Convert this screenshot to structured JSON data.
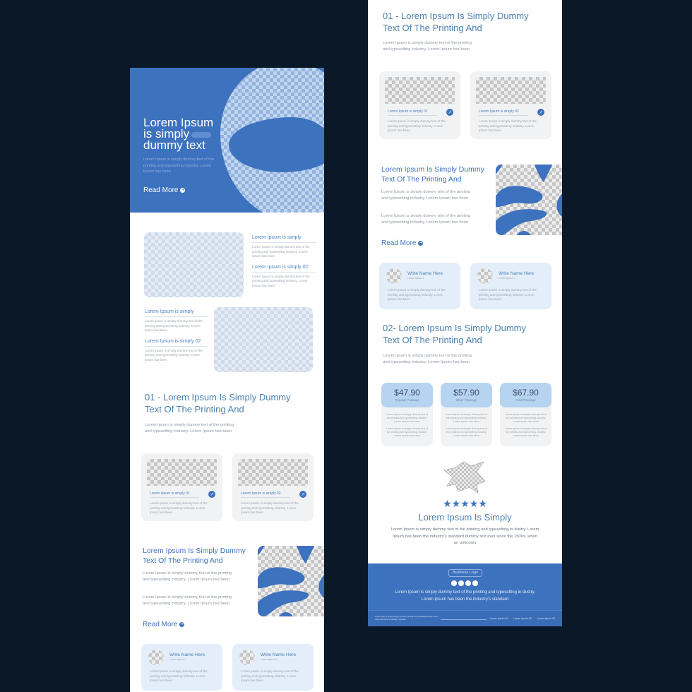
{
  "colors": {
    "background": "#0a1828",
    "brand_blue": "#3d72be",
    "heading_blue": "#4a7fb0",
    "price_header": "#b6d3f0",
    "testimonial_card": "#e3eefa",
    "card_grey": "#f1f2f4"
  },
  "left_page": {
    "hero": {
      "title_line1": "Lorem Ipsum",
      "title_line2": "is simply",
      "title_line3": "dummy text",
      "body": "Lorem Ipsum is simply dummy text of the printing and typesetting industry. Lorem Ipsum has been",
      "read_more": "Read More",
      "read_more_icon": "arrow-circle-icon"
    },
    "features": {
      "row1": [
        {
          "title": "Lorem Ipsum is simply",
          "body": "Lorem Ipsum is simply dummy text of the printing and typesetting industry. Lorem Ipsum has been"
        },
        {
          "title": "Lorem Ipsum is simply 02",
          "body": "Lorem Ipsum is simply dummy text of the printing and typesetting industry. Lorem Ipsum has been"
        }
      ],
      "row2": [
        {
          "title": "Lorem Ipsum is simply",
          "body": "Lorem Ipsum is simply dummy text of the printing and typesetting industry. Lorem Ipsum has been"
        },
        {
          "title": "Lorem Ipsum is simply 02",
          "body": "Lorem Ipsum is simply dummy text of the printing and typesetting industry. Lorem Ipsum has been"
        }
      ]
    },
    "section01": {
      "title_line1": "01 - Lorem Ipsum Is Simply Dummy",
      "title_line2": "Text Of The Printing And",
      "body": "Lorem Ipsum is simply dummy text of the printing and typesetting industry. Lorem Ipsum has been",
      "cards": [
        {
          "title": "Lorem Ipsum is simply 01",
          "body": "Lorem Ipsum is simply dummy text of the printing and typesetting industry. Lorem Ipsum has been",
          "icon": "arrow-up-right-icon"
        },
        {
          "title": "Lorem Ipsum is simply 02",
          "body": "Lorem Ipsum is simply dummy text of the printing and typesetting industry. Lorem Ipsum has been",
          "icon": "arrow-up-right-icon"
        }
      ]
    },
    "split": {
      "title_line1": "Lorem Ipsum Is Simply Dummy",
      "title_line2": "Text Of The Printing And",
      "body1": "Lorem Ipsum is simply dummy text of the printing and typesetting industry. Lorem Ipsum has been",
      "body2": "Lorem Ipsum is simply dummy text of the printing and typesetting industry. Lorem Ipsum has been",
      "read_more": "Read More"
    },
    "testimonials": [
      {
        "name": "Write Name Here",
        "subtitle": "Lorem Ipsum 1",
        "body": "Lorem Ipsum is simply dummy text of the printing and typesetting industry. Lorem Ipsum has been"
      },
      {
        "name": "Write Name Here",
        "subtitle": "Lorem Ipsum 2",
        "body": "Lorem Ipsum is simply dummy text of the printing and typesetting industry. Lorem Ipsum has been"
      }
    ]
  },
  "right_page": {
    "section01": {
      "title_line1": "01 - Lorem Ipsum Is Simply Dummy",
      "title_line2": "Text Of The Printing And",
      "body": "Lorem Ipsum is simply dummy text of the printing and typesetting industry. Lorem Ipsum has been",
      "cards": [
        {
          "title": "Lorem Ipsum is simply 01",
          "body": "Lorem Ipsum is simply dummy text of the printing and typesetting industry. Lorem Ipsum has been"
        },
        {
          "title": "Lorem Ipsum is simply 02",
          "body": "Lorem Ipsum is simply dummy text of the printing and typesetting industry. Lorem Ipsum has been"
        }
      ]
    },
    "split": {
      "title_line1": "Lorem Ipsum Is Simply Dummy",
      "title_line2": "Text Of The Printing And",
      "body1": "Lorem Ipsum is simply dummy text of the printing and typesetting industry. Lorem Ipsum has been",
      "body2": "Lorem Ipsum is simply dummy text of the printing and typesetting industry. Lorem Ipsum has been",
      "read_more": "Read More"
    },
    "testimonials": [
      {
        "name": "Write Name Here",
        "subtitle": "Lorem Ipsum 1",
        "body": "Lorem Ipsum is simply dummy text of the printing and typesetting industry. Lorem Ipsum has been"
      },
      {
        "name": "Write Name Here",
        "subtitle": "Lorem Ipsum 2",
        "body": "Lorem Ipsum is simply dummy text of the printing and typesetting industry. Lorem Ipsum has been"
      }
    ],
    "section02": {
      "title_line1": "02- Lorem Ipsum Is Simply Dummy",
      "title_line2": "Text Of The Printing And",
      "body": "Lorem Ipsum is simply dummy text of the printing and typesetting industry. Lorem Ipsum has been"
    },
    "pricing": [
      {
        "price": "$47.90",
        "name": "Regular Package",
        "line1": "Lorem Ipsum is simply dummy text of the printing and typesetting industry. Lorem Ipsum has been",
        "line2": "Lorem Ipsum is simply dummy text of the printing and typesetting industry. Lorem Ipsum has been"
      },
      {
        "price": "$57.90",
        "name": "Silver Package",
        "line1": "Lorem Ipsum is simply dummy text of the printing and typesetting industry. Lorem Ipsum has been",
        "line2": "Lorem Ipsum is simply dummy text of the printing and typesetting industry. Lorem Ipsum has been"
      },
      {
        "price": "$67.90",
        "name": "Gold Package",
        "line1": "Lorem Ipsum is simply dummy text of the printing and typesetting industry. Lorem Ipsum has been",
        "line2": "Lorem Ipsum is simply dummy text of the printing and typesetting industry. Lorem Ipsum has been"
      }
    ],
    "review": {
      "stars": "★★★★★",
      "rating": 5,
      "rating_max": 5,
      "title": "Lorem Ipsum Is Simply",
      "body": "Lorem Ipsum is simply dummy text of the printing and typesetting in-dustry. Lorem Ipsum has been the industry's standard dummy text ever since the 1500s, when an unknown"
    },
    "footer": {
      "logo": "Business Logo",
      "social_icons": [
        "social-icon-1",
        "social-icon-2",
        "social-icon-3",
        "social-icon-4"
      ],
      "text": "Lorem Ipsum is simply dummy text of the printing and typesetting in-dustry. Lorem Ipsum has been the industry's standard",
      "bottom_text": "Lorem Ipsum is simply dummy text of the printing and typesetting industry. Lorem Ipsum has been the industry's standard",
      "links": [
        "Lorem Ipsum 01",
        "Lorem Ipsum 02",
        "Lorem Ipsum 03"
      ]
    }
  }
}
